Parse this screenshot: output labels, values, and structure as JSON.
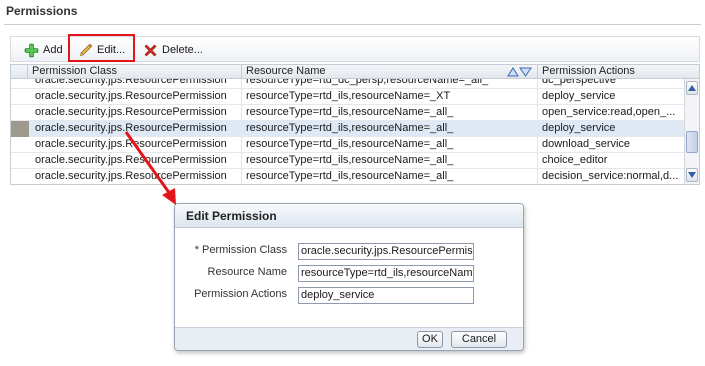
{
  "section": {
    "title": "Permissions"
  },
  "toolbar": {
    "add_label": "Add",
    "edit_label": "Edit...",
    "delete_label": "Delete..."
  },
  "table": {
    "columns": [
      "Permission Class",
      "Resource Name",
      "Permission Actions"
    ],
    "partial_row": {
      "class": "oracle.security.jps.ResourcePermission",
      "resource": "resourceType=rtd_dc_persp,resourceName=_all_",
      "actions": "dc_perspective"
    },
    "rows": [
      {
        "class": "oracle.security.jps.ResourcePermission",
        "resource": "resourceType=rtd_ils,resourceName=_XT",
        "actions": "deploy_service"
      },
      {
        "class": "oracle.security.jps.ResourcePermission",
        "resource": "resourceType=rtd_ils,resourceName=_all_",
        "actions": "open_service:read,open_..."
      },
      {
        "class": "oracle.security.jps.ResourcePermission",
        "resource": "resourceType=rtd_ils,resourceName=_all_",
        "actions": "deploy_service"
      },
      {
        "class": "oracle.security.jps.ResourcePermission",
        "resource": "resourceType=rtd_ils,resourceName=_all_",
        "actions": "download_service"
      },
      {
        "class": "oracle.security.jps.ResourcePermission",
        "resource": "resourceType=rtd_ils,resourceName=_all_",
        "actions": "choice_editor"
      },
      {
        "class": "oracle.security.jps.ResourcePermission",
        "resource": "resourceType=rtd_ils,resourceName=_all_",
        "actions": "decision_service:normal,d..."
      }
    ],
    "selected_row_index": 2
  },
  "dialog": {
    "title": "Edit Permission",
    "fields": {
      "permission_class": {
        "label": "* Permission Class",
        "value": "oracle.security.jps.ResourcePermission"
      },
      "resource_name": {
        "label": "Resource Name",
        "value": "resourceType=rtd_ils,resourceName=_all_"
      },
      "permission_actions": {
        "label": "Permission Actions",
        "value": "deploy_service"
      }
    },
    "ok_label": "OK",
    "cancel_label": "Cancel"
  },
  "colors": {
    "highlight": "#e3151a",
    "selected_row": "#dfe8f5",
    "add_icon": "#3aa335",
    "delete_icon": "#d62b1f"
  },
  "icons": [
    "add-icon",
    "pencil-icon",
    "delete-icon",
    "sort-ascending-icon",
    "sort-descending-icon",
    "scroll-up-icon",
    "scroll-down-icon"
  ]
}
